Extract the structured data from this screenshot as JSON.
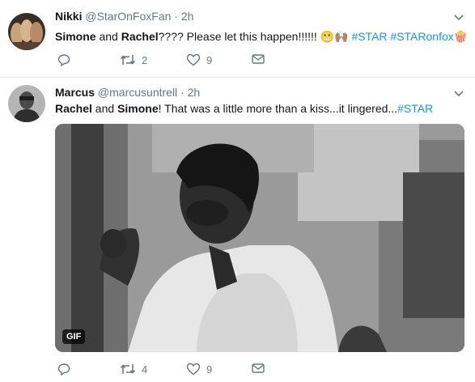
{
  "tweets": [
    {
      "name": "Nikki",
      "handle": "@StarOnFoxFan",
      "time": "· 2h",
      "text_bold1": "Simone",
      "text_and": " and ",
      "text_bold2": "Rachel",
      "text_rest": "???? Please let this happen!!!!!! ",
      "emoji1": "😬",
      "emoji2": "🙌🏽",
      "tag1": "#STAR",
      "tag2": "#STARonfox",
      "emoji3": "🍿",
      "replies": "",
      "retweets": "2",
      "likes": "9"
    },
    {
      "name": "Marcus",
      "handle": "@marcusuntrell",
      "time": "· 2h",
      "text_bold1": "Rachel",
      "text_and": " and ",
      "text_bold2": "Simone",
      "text_rest": "! That was a little more than a kiss...it lingered...",
      "tag1": "#STAR",
      "media_badge": "GIF",
      "replies": "",
      "retweets": "4",
      "likes": "9"
    }
  ],
  "colors": {
    "link": "#1b95e0",
    "muted": "#657786",
    "text": "#14171a"
  },
  "icons": [
    "reply-icon",
    "retweet-icon",
    "like-icon",
    "dm-icon",
    "chevron-down-icon"
  ]
}
